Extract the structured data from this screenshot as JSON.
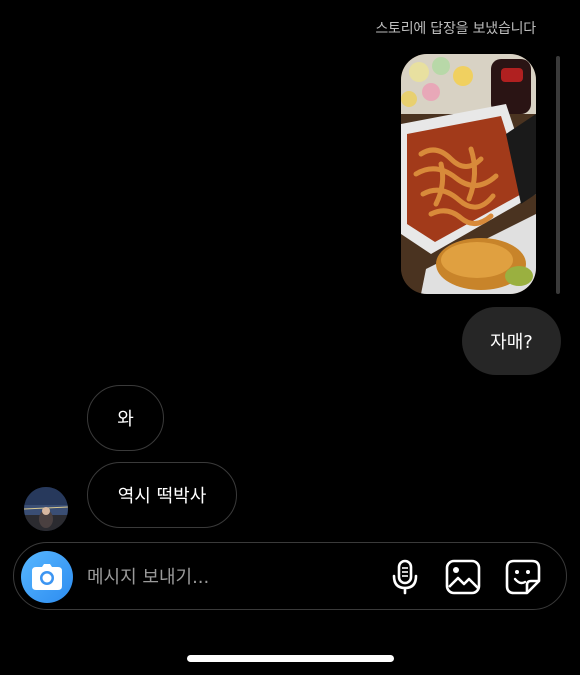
{
  "thread": {
    "story_reply_note": "스토리에 답장을 보냈습니다",
    "outgoing_messages": [
      {
        "text": "자매?"
      }
    ],
    "incoming_messages": [
      {
        "text": "와"
      },
      {
        "text": "역시 떡박사"
      }
    ]
  },
  "composer": {
    "placeholder": "메시지 보내기...",
    "value": ""
  },
  "icons": {
    "camera": "camera-icon",
    "microphone": "microphone-icon",
    "gallery": "gallery-icon",
    "sticker": "sticker-icon"
  },
  "colors": {
    "background": "#000000",
    "outgoing_bubble": "#262626",
    "incoming_bubble_border": "#3a3a3a",
    "camera_button": "#3897f0",
    "secondary_text": "#bdbdbd"
  }
}
